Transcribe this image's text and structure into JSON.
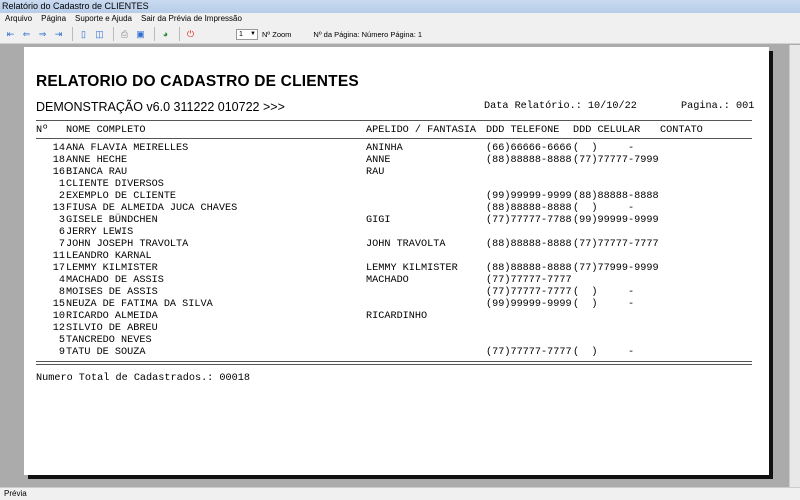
{
  "window": {
    "title": "Relatório do Cadastro de CLIENTES"
  },
  "menu": [
    "Arquivo",
    "Página",
    "Suporte e Ajuda",
    "Sair da Prévia de Impressão"
  ],
  "toolbar": {
    "zoom_value": "1",
    "zoom_label": "Nº Zoom",
    "page_label": "Nº da Página: Número Página: 1"
  },
  "report": {
    "title": "RELATORIO DO CADASTRO DE CLIENTES",
    "subtitle": "DEMONSTRAÇÃO v6.0 311222 010722 >>>",
    "date": "Data Relatório.: 10/10/22",
    "page": "Pagina.: 001",
    "headers": [
      "Nº",
      "NOME COMPLETO",
      "APELIDO / FANTASIA",
      "DDD TELEFONE",
      "DDD CELULAR",
      "CONTATO"
    ],
    "rows": [
      [
        "14",
        "ANA FLAVIA MEIRELLES",
        "ANINHA",
        "(66)66666-6666",
        "(  )     -"
      ],
      [
        "18",
        "ANNE HECHE",
        "ANNE",
        "(88)88888-8888",
        "(77)77777-7999"
      ],
      [
        "16",
        "BIANCA RAU",
        "RAU",
        "",
        ""
      ],
      [
        "1",
        "CLIENTE DIVERSOS",
        "",
        "",
        ""
      ],
      [
        "2",
        "EXEMPLO DE CLIENTE",
        "",
        "(99)99999-9999",
        "(88)88888-8888"
      ],
      [
        "13",
        "FIUSA DE ALMEIDA JUCA CHAVES",
        "",
        "(88)88888-8888",
        "(  )     -"
      ],
      [
        "3",
        "GISELE BÜNDCHEN",
        "GIGI",
        "(77)77777-7788",
        "(99)99999-9999"
      ],
      [
        "6",
        "JERRY LEWIS",
        "",
        "",
        ""
      ],
      [
        "7",
        "JOHN JOSEPH TRAVOLTA",
        "JOHN TRAVOLTA",
        "(88)88888-8888",
        "(77)77777-7777"
      ],
      [
        "11",
        "LEANDRO KARNAL",
        "",
        "",
        ""
      ],
      [
        "17",
        "LEMMY KILMISTER",
        "LEMMY KILMISTER",
        "(88)88888-8888",
        "(77)77999-9999"
      ],
      [
        "4",
        "MACHADO DE ASSIS",
        "MACHADO",
        "(77)77777-7777",
        ""
      ],
      [
        "8",
        "MOISES DE ASSIS",
        "",
        "(77)77777-7777",
        "(  )     -"
      ],
      [
        "15",
        "NEUZA DE FATIMA DA SILVA",
        "",
        "(99)99999-9999",
        "(  )     -"
      ],
      [
        "10",
        "RICARDO ALMEIDA",
        "RICARDINHO",
        "",
        ""
      ],
      [
        "12",
        "SILVIO DE ABREU",
        "",
        "",
        ""
      ],
      [
        "5",
        "TANCREDO NEVES",
        "",
        "",
        ""
      ],
      [
        "9",
        "TATU DE SOUZA",
        "",
        "(77)77777-7777",
        "(  )     -"
      ]
    ],
    "total": "Numero Total de Cadastrados.: 00018"
  },
  "status": {
    "text": "Prévia"
  }
}
